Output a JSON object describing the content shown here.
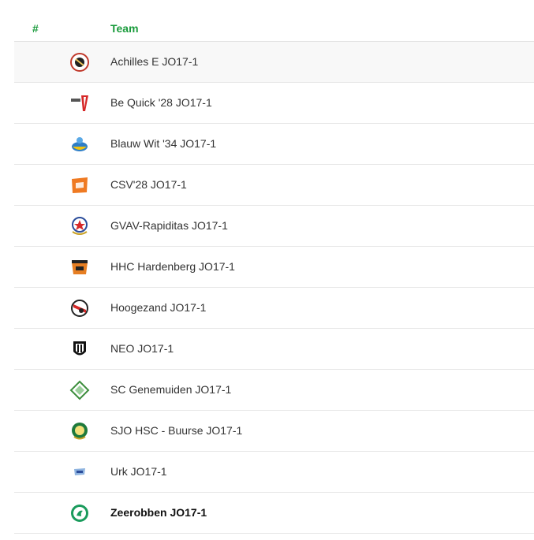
{
  "header": {
    "num_label": "#",
    "team_label": "Team"
  },
  "teams": [
    {
      "name": "Achilles E JO17-1",
      "logo": "achilles-logo",
      "own": false
    },
    {
      "name": "Be Quick '28 JO17-1",
      "logo": "be-quick-logo",
      "own": false
    },
    {
      "name": "Blauw Wit '34 JO17-1",
      "logo": "blauw-wit-logo",
      "own": false
    },
    {
      "name": "CSV'28 JO17-1",
      "logo": "csv28-logo",
      "own": false
    },
    {
      "name": "GVAV-Rapiditas JO17-1",
      "logo": "gvav-logo",
      "own": false
    },
    {
      "name": "HHC Hardenberg JO17-1",
      "logo": "hhc-logo",
      "own": false
    },
    {
      "name": "Hoogezand JO17-1",
      "logo": "hoogezand-logo",
      "own": false
    },
    {
      "name": "NEO JO17-1",
      "logo": "neo-logo",
      "own": false
    },
    {
      "name": "SC Genemuiden JO17-1",
      "logo": "sc-genemuiden-logo",
      "own": false
    },
    {
      "name": "SJO HSC - Buurse JO17-1",
      "logo": "sjo-hsc-buurse-logo",
      "own": false
    },
    {
      "name": "Urk JO17-1",
      "logo": "urk-logo",
      "own": false
    },
    {
      "name": "Zeerobben JO17-1",
      "logo": "zeerobben-logo",
      "own": true
    }
  ],
  "colors": {
    "accent": "#1a9b3c",
    "text": "#333333",
    "divider": "#e6e6e6"
  }
}
